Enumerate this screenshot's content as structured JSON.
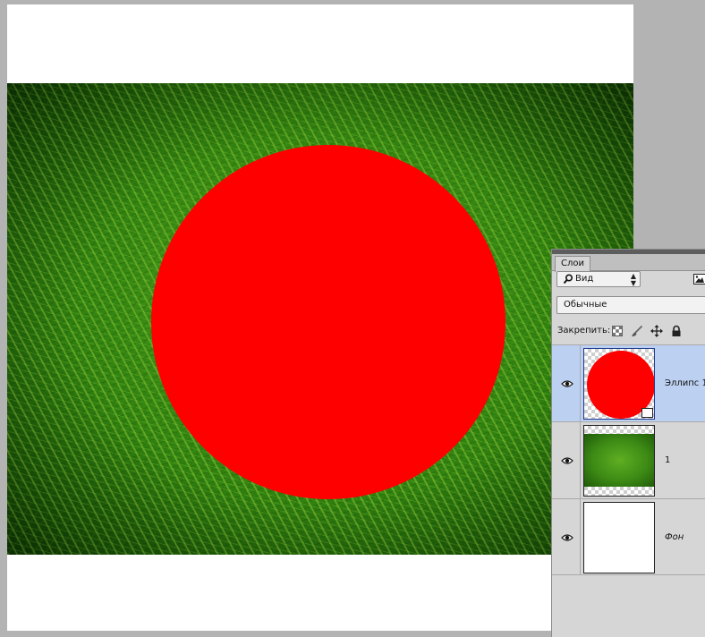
{
  "canvas": {
    "shape_color": "#ff0000",
    "background_color": "#ffffff"
  },
  "layers_panel": {
    "tab_label": "Слои",
    "filter": {
      "value": "Вид",
      "icon": "magnifier-icon"
    },
    "blend_mode": "Обычные",
    "lock_label": "Закрепить:",
    "lock_icons": [
      "lock-transparent-icon",
      "lock-brush-icon",
      "lock-move-icon",
      "lock-all-icon"
    ],
    "layers": [
      {
        "name": "Эллипс 1",
        "selected": true,
        "visible": true
      },
      {
        "name": "1",
        "selected": false,
        "visible": true
      },
      {
        "name": "Фон",
        "selected": false,
        "visible": true
      }
    ]
  }
}
